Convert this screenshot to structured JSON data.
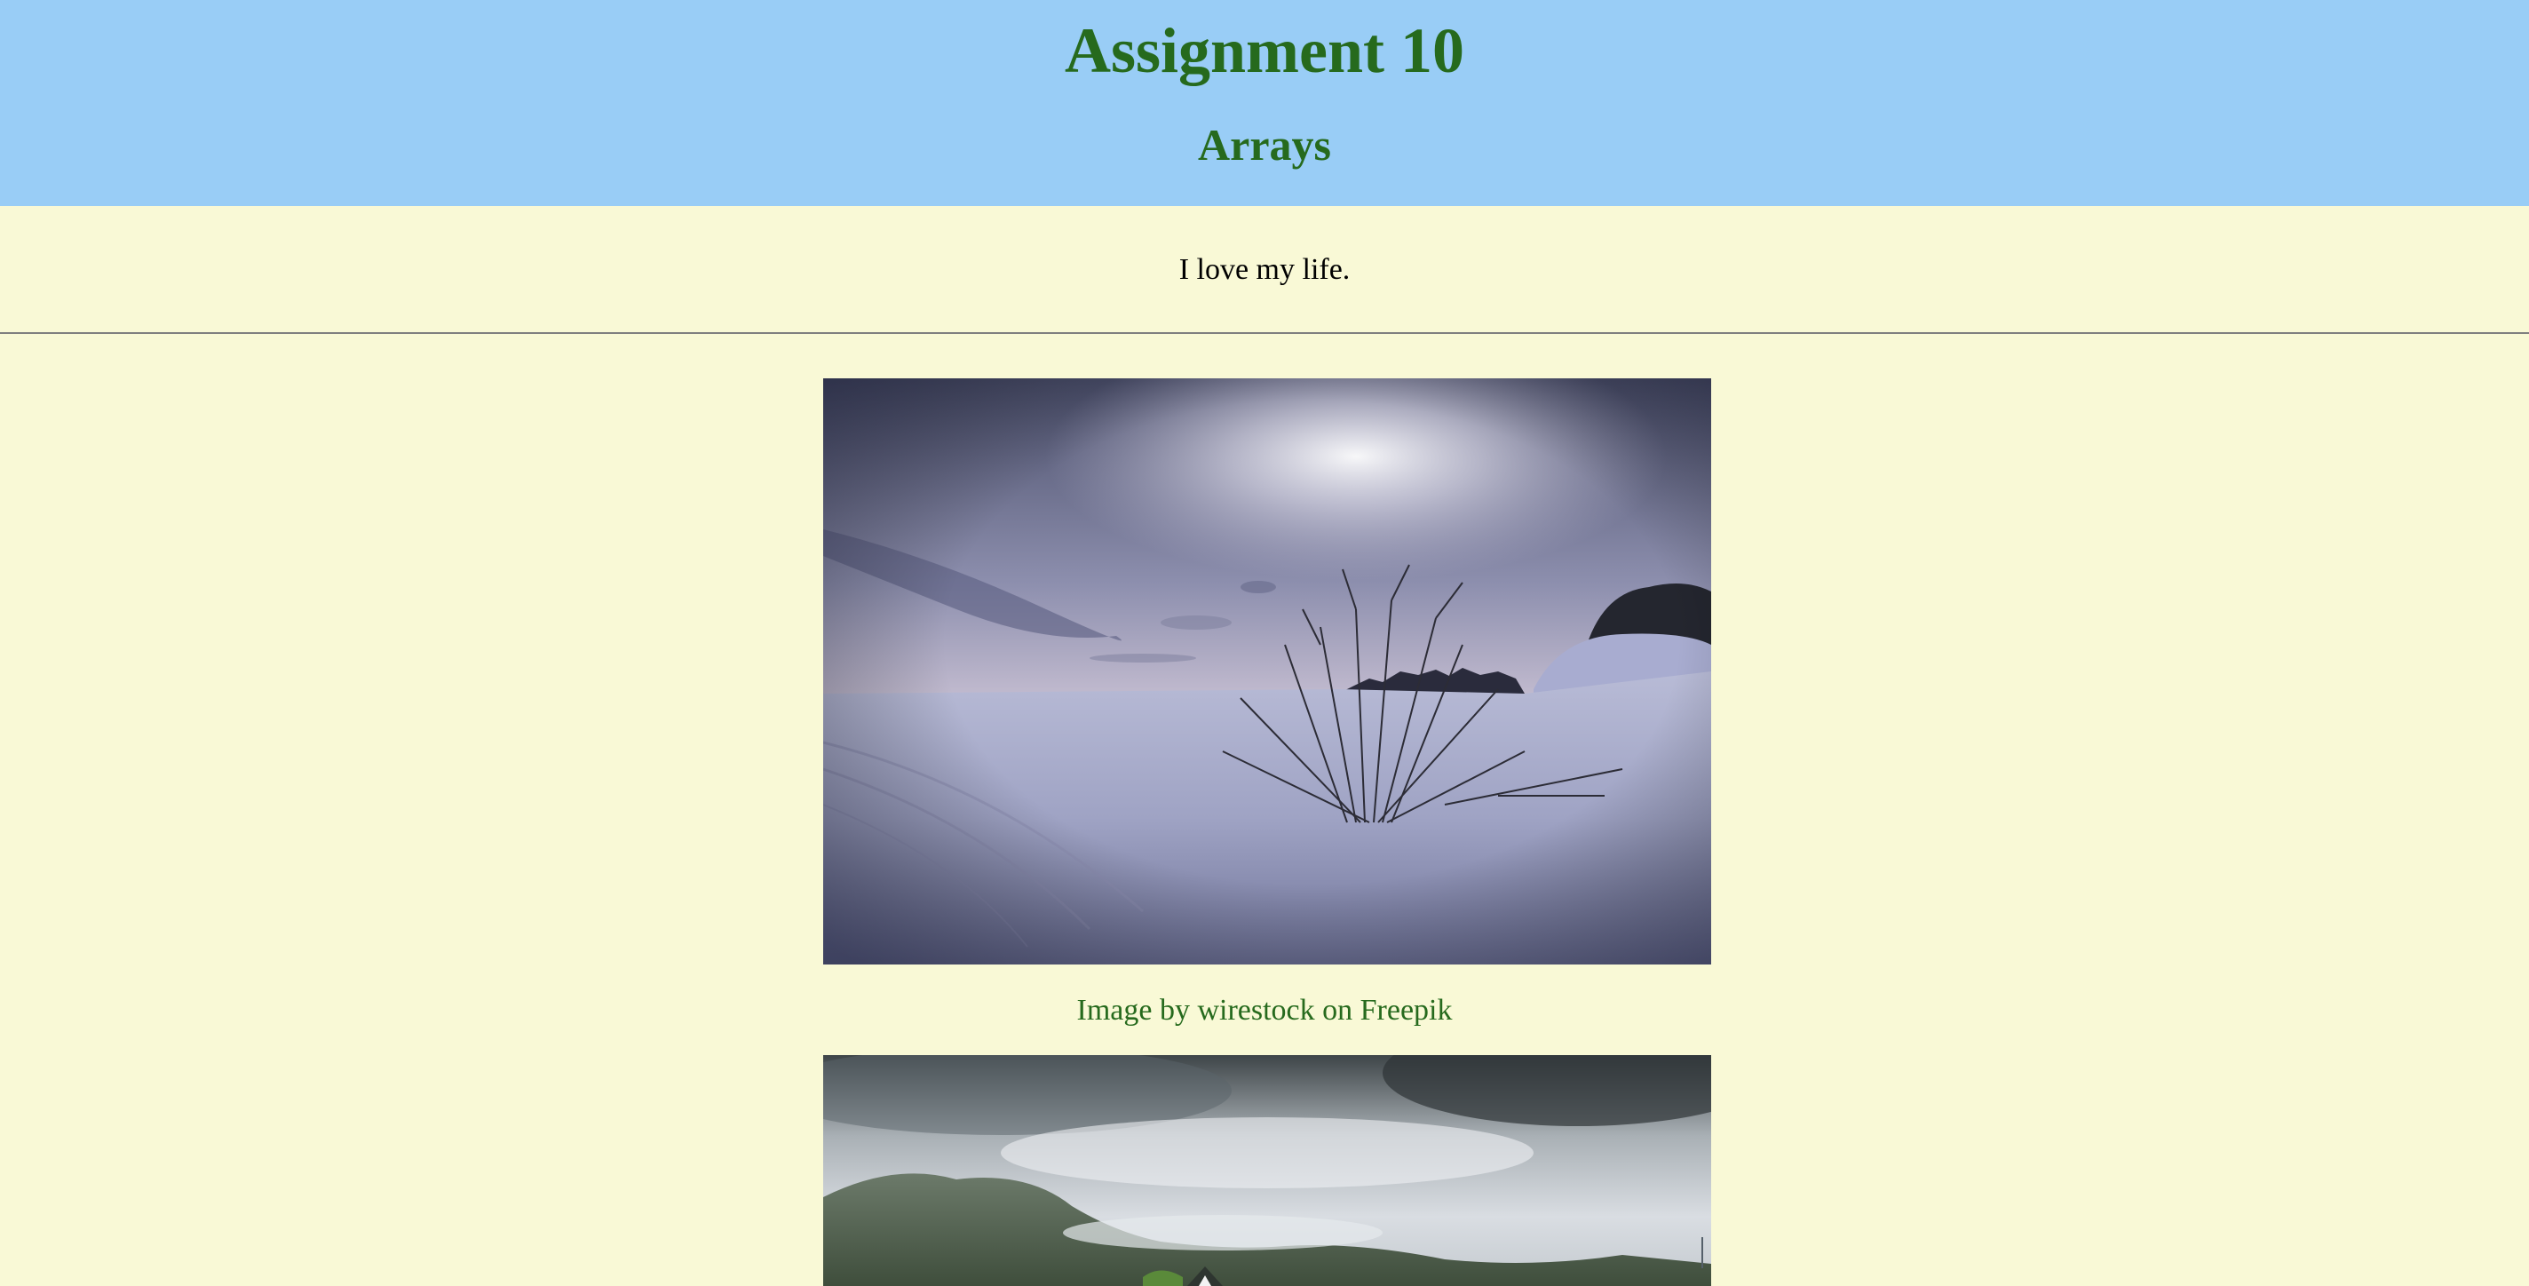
{
  "header": {
    "title": "Assignment 10",
    "subtitle": "Arrays"
  },
  "intro": {
    "text": "I love my life."
  },
  "gallery": {
    "images": [
      {
        "scene": "snowy-field-at-dusk",
        "caption": "Image by wirestock on Freepik"
      },
      {
        "scene": "cloudy-mountains-with-house",
        "caption": ""
      }
    ]
  },
  "colors": {
    "header_bg": "#99cdf6",
    "page_bg": "#f9f9d6",
    "heading_text": "#266a1d",
    "caption_text": "#266a1d",
    "body_text": "#000000"
  }
}
